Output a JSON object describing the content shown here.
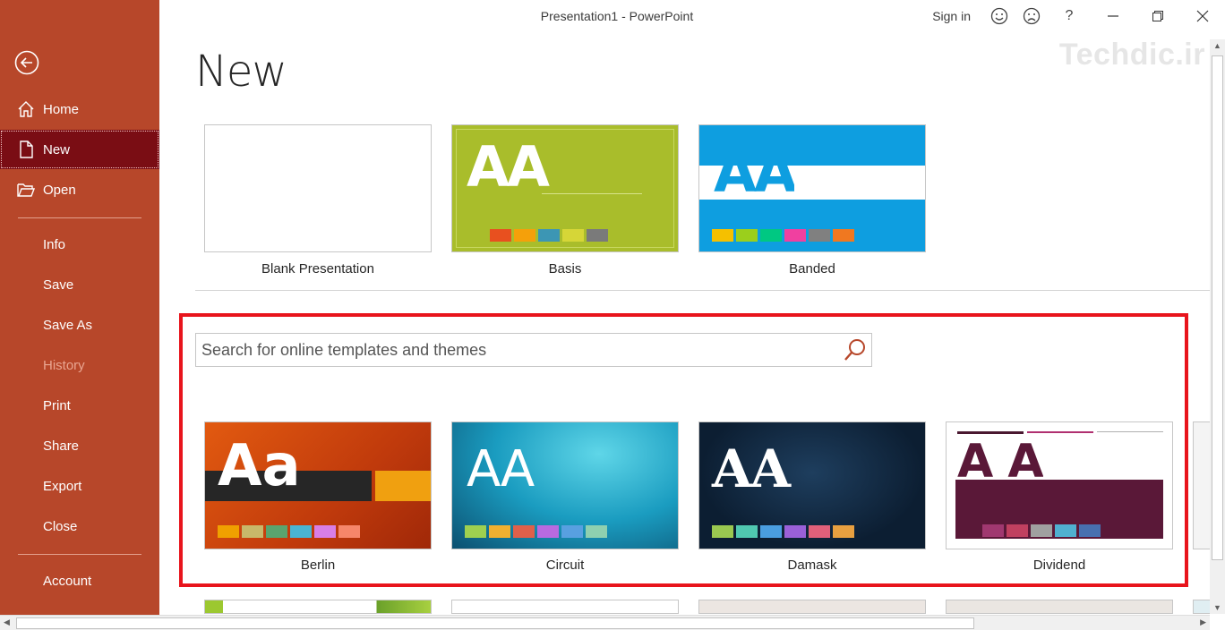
{
  "window": {
    "title": "Presentation1  -  PowerPoint",
    "sign_in": "Sign in",
    "help": "?",
    "watermark": "Techdic.ir"
  },
  "sidebar": {
    "home": "Home",
    "new": "New",
    "open": "Open",
    "info": "Info",
    "save": "Save",
    "save_as": "Save As",
    "history": "History",
    "print": "Print",
    "share": "Share",
    "export": "Export",
    "close": "Close",
    "account": "Account"
  },
  "main": {
    "heading": "New",
    "featured": [
      {
        "label": "Blank Presentation"
      },
      {
        "label": "Basis",
        "swatches": [
          "#e8501f",
          "#f5a00a",
          "#3c96b4",
          "#d6d637",
          "#7a7a7a"
        ]
      },
      {
        "label": "Banded",
        "swatches": [
          "#f5c000",
          "#9bcf1c",
          "#00c882",
          "#f040a0",
          "#808080",
          "#f07820"
        ]
      }
    ],
    "search": {
      "placeholder": "Search for online templates and themes"
    },
    "themes": [
      {
        "label": "Berlin",
        "swatches": [
          "#f0a000",
          "#c8b86a",
          "#5aa46e",
          "#4ab4d2",
          "#d87ee6",
          "#f6866a"
        ]
      },
      {
        "label": "Circuit",
        "swatches": [
          "#9ed050",
          "#f0b030",
          "#e0604a",
          "#b86ae0",
          "#58a0e0",
          "#8ed0b0"
        ]
      },
      {
        "label": "Damask",
        "swatches": [
          "#9ac850",
          "#50c8b0",
          "#4a9ee0",
          "#9a60d8",
          "#e0607a",
          "#e8a040"
        ]
      },
      {
        "label": "Dividend",
        "swatches": [
          "#a03870",
          "#c04060",
          "#a0a0a0",
          "#50b0d0",
          "#4870b0"
        ]
      }
    ]
  },
  "colors": {
    "sidebar_bg": "#b7472a",
    "active_item": "#7a0d14",
    "highlight": "#e8141c"
  }
}
